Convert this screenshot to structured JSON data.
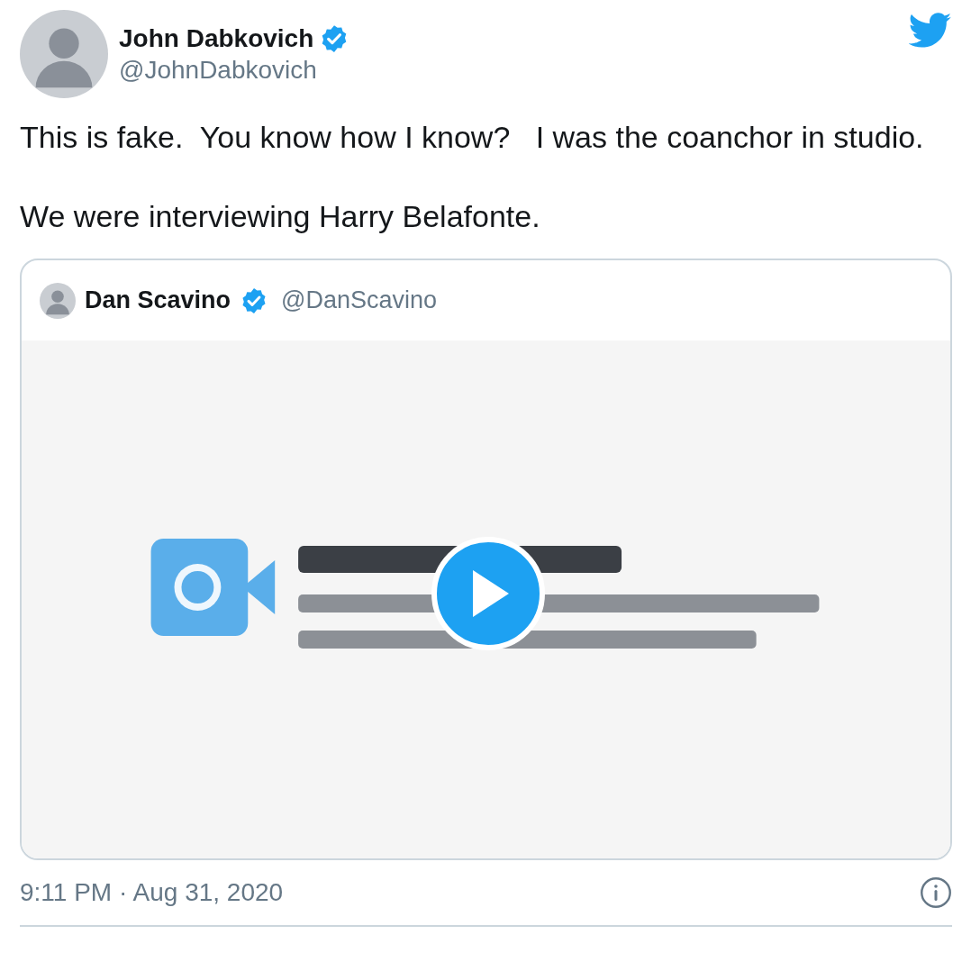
{
  "author": {
    "name": "John Dabkovich",
    "handle": "@JohnDabkovich",
    "verified": true
  },
  "text": [
    "This is fake.  You know how I know?   I was the coanchor in studio.",
    "We were interviewing Harry Belafonte."
  ],
  "quoted_tweet": {
    "name": "Dan Scavino",
    "handle": "@DanScavino",
    "verified": true
  },
  "timestamp": "9:11 PM · Aug 31, 2020"
}
